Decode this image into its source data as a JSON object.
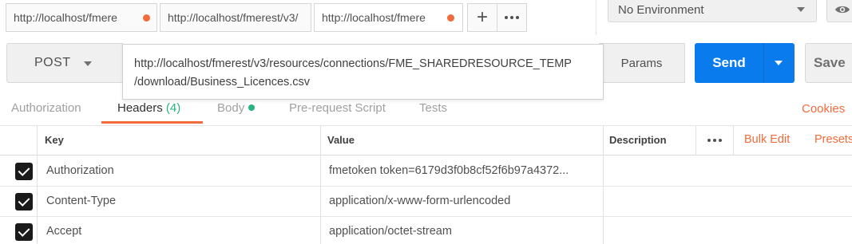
{
  "tabs": [
    {
      "label": "http://localhost/fmere",
      "unsaved": true
    },
    {
      "label": "http://localhost/fmerest/v3/",
      "unsaved": false
    },
    {
      "label": "http://localhost/fmere",
      "unsaved": true
    }
  ],
  "tab_add_icon": "plus-icon",
  "tab_more_icon": "ellipsis-icon",
  "environment": {
    "selected": "No Environment",
    "eye_icon": "eye-icon"
  },
  "request": {
    "method": "POST",
    "url_line1": "http://localhost/fmerest/v3/resources/connections/FME_SHAREDRESOURCE_TEMP",
    "url_line2": "/download/Business_Licences.csv",
    "params_label": "Params",
    "send_label": "Send",
    "save_label": "Save"
  },
  "subtabs": {
    "authorization": "Authorization",
    "headers": "Headers",
    "headers_count": "(4)",
    "body": "Body",
    "prerequest": "Pre-request Script",
    "tests": "Tests",
    "cookies": "Cookies"
  },
  "table": {
    "columns": {
      "key": "Key",
      "value": "Value",
      "description": "Description"
    },
    "bulk_edit": "Bulk Edit",
    "presets": "Presets",
    "rows": [
      {
        "checked": true,
        "key": "Authorization",
        "value": "fmetoken token=6179d3f0b8cf52f6b97a4372...",
        "description": ""
      },
      {
        "checked": true,
        "key": "Content-Type",
        "value": "application/x-www-form-urlencoded",
        "description": ""
      },
      {
        "checked": true,
        "key": "Accept",
        "value": "application/octet-stream",
        "description": ""
      }
    ]
  },
  "colors": {
    "accent": "#f26b3a",
    "send": "#097bed",
    "success": "#26b47f"
  }
}
